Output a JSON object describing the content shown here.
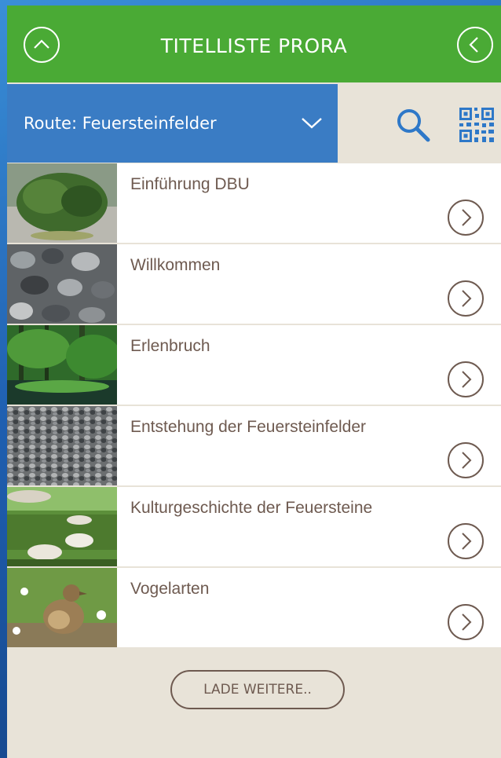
{
  "header": {
    "title": "TITELLISTE PRORA"
  },
  "route": {
    "label": "Route: Feuersteinfelder"
  },
  "items": [
    {
      "title": "Einführung DBU"
    },
    {
      "title": "Willkommen"
    },
    {
      "title": "Erlenbruch"
    },
    {
      "title": "Entstehung der Feuersteinfelder"
    },
    {
      "title": "Kulturgeschichte der Feuersteine"
    },
    {
      "title": "Vogelarten"
    }
  ],
  "load_more": {
    "label": "LADE WEITERE.."
  },
  "colors": {
    "header_green": "#4aaa35",
    "route_blue": "#3a7cc4",
    "text_brown": "#6e5a50",
    "background": "#e8e3d8"
  }
}
